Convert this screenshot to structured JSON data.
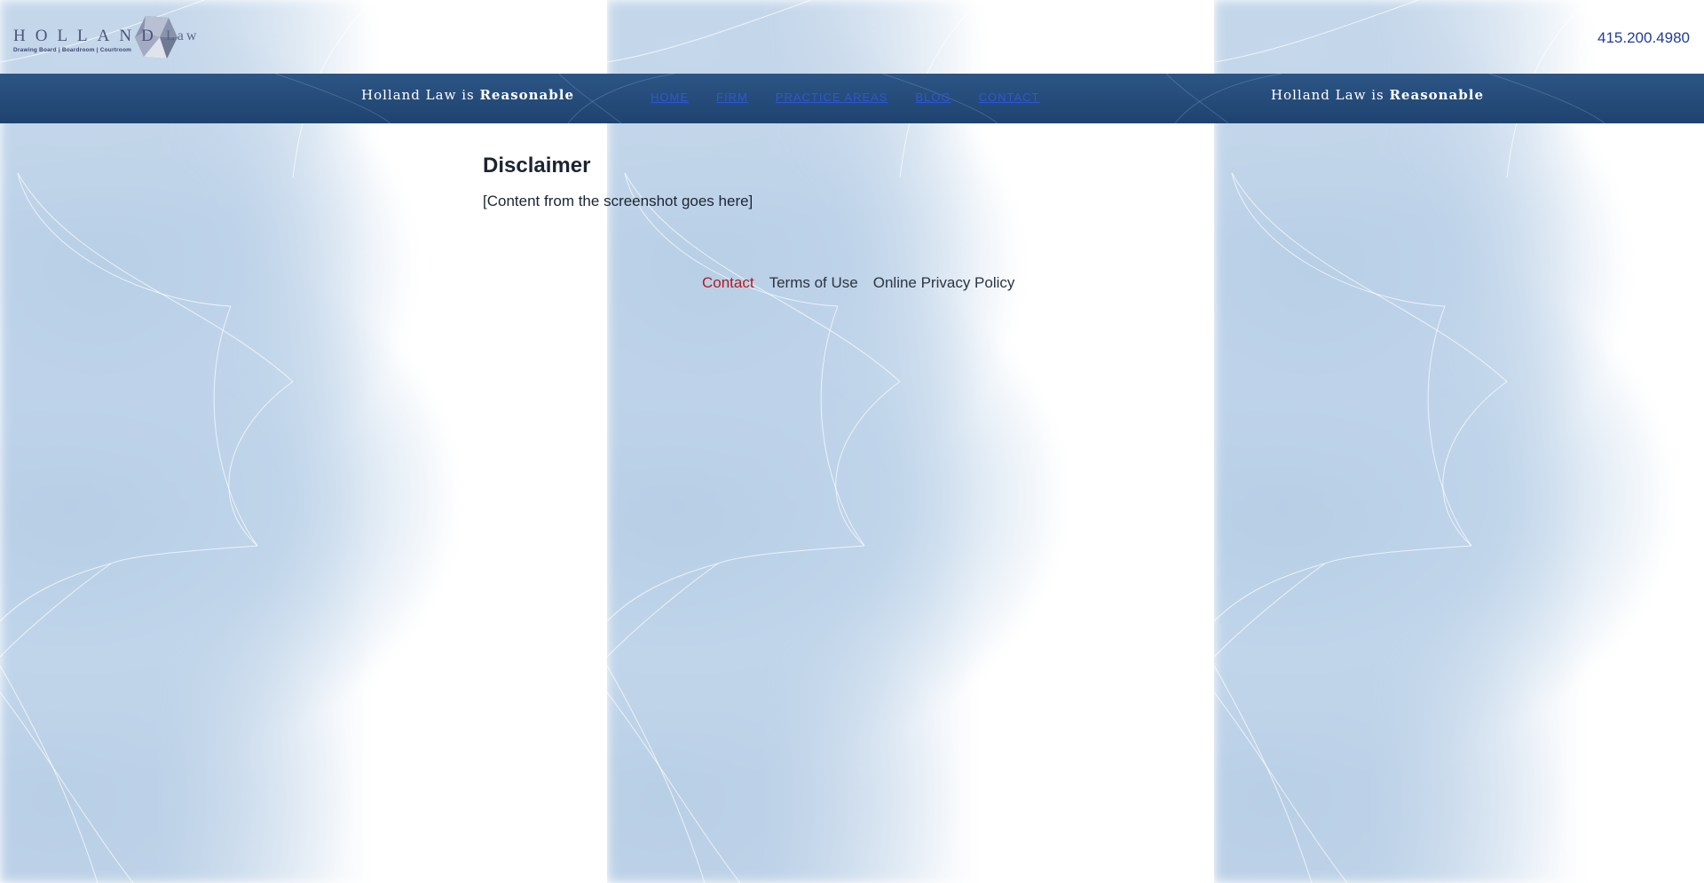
{
  "header": {
    "logo": {
      "name": "HOLLAND",
      "suffix": "Law",
      "tagline": "Drawing Board | Boardroom | Courtroom"
    },
    "phone": "415.200.4980"
  },
  "banner": {
    "tagline_prefix": "Holland Law is",
    "tagline_emphasis": "Reasonable"
  },
  "nav": {
    "items": [
      "HOME",
      "FIRM",
      "PRACTICE AREAS",
      "BLOG",
      "CONTACT"
    ]
  },
  "main": {
    "title": "Disclaimer",
    "body": "[Content from the screenshot goes here]"
  },
  "footer": {
    "links": [
      "Contact",
      "Terms of Use",
      "Online Privacy Policy"
    ],
    "active": "Contact"
  },
  "colors": {
    "nav_bar": "#244a78",
    "nav_link": "#2e57d6",
    "phone": "#1f3d99",
    "footer_active": "#b21a24",
    "background_tile": "#b9cfe6"
  }
}
